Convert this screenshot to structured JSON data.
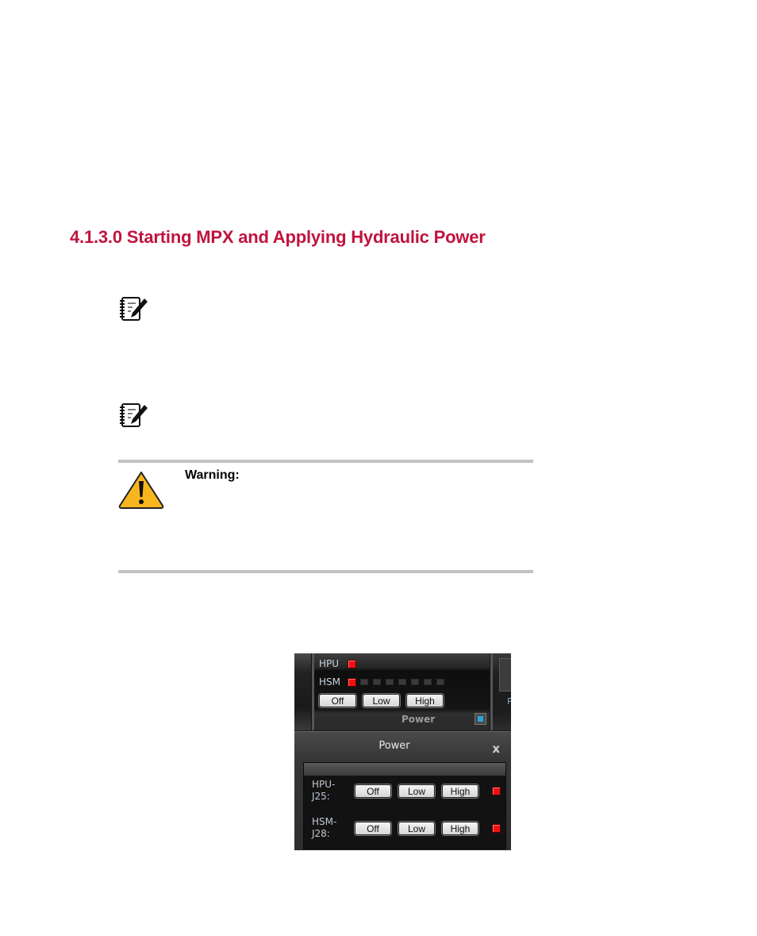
{
  "document": {
    "heading": "4.1.3.0 Starting MPX and Applying Hydraulic Power",
    "notes": [
      {
        "icon": "note-pencil-icon"
      },
      {
        "icon": "note-pencil-icon"
      }
    ],
    "warning": {
      "icon": "warning-triangle-icon",
      "label": "Warning:"
    },
    "accent_color": "#c0143c"
  },
  "screenshot": {
    "toolbar": {
      "hpu_label": "HPU",
      "hsm_label": "HSM",
      "buttons": [
        "Off",
        "Low",
        "High"
      ],
      "panel_title": "Power",
      "right_label": "P",
      "hpu_status": "on",
      "hsm_status": "on"
    },
    "dialog": {
      "title": "Power",
      "close_label": "x",
      "rows": [
        {
          "label_line1": "HPU-",
          "label_line2": "J25:",
          "buttons": [
            "Off",
            "Low",
            "High"
          ],
          "status": "on"
        },
        {
          "label_line1": "HSM-",
          "label_line2": "J28:",
          "buttons": [
            "Off",
            "Low",
            "High"
          ],
          "status": "on"
        }
      ]
    },
    "indicator_color": "#ee1111"
  }
}
